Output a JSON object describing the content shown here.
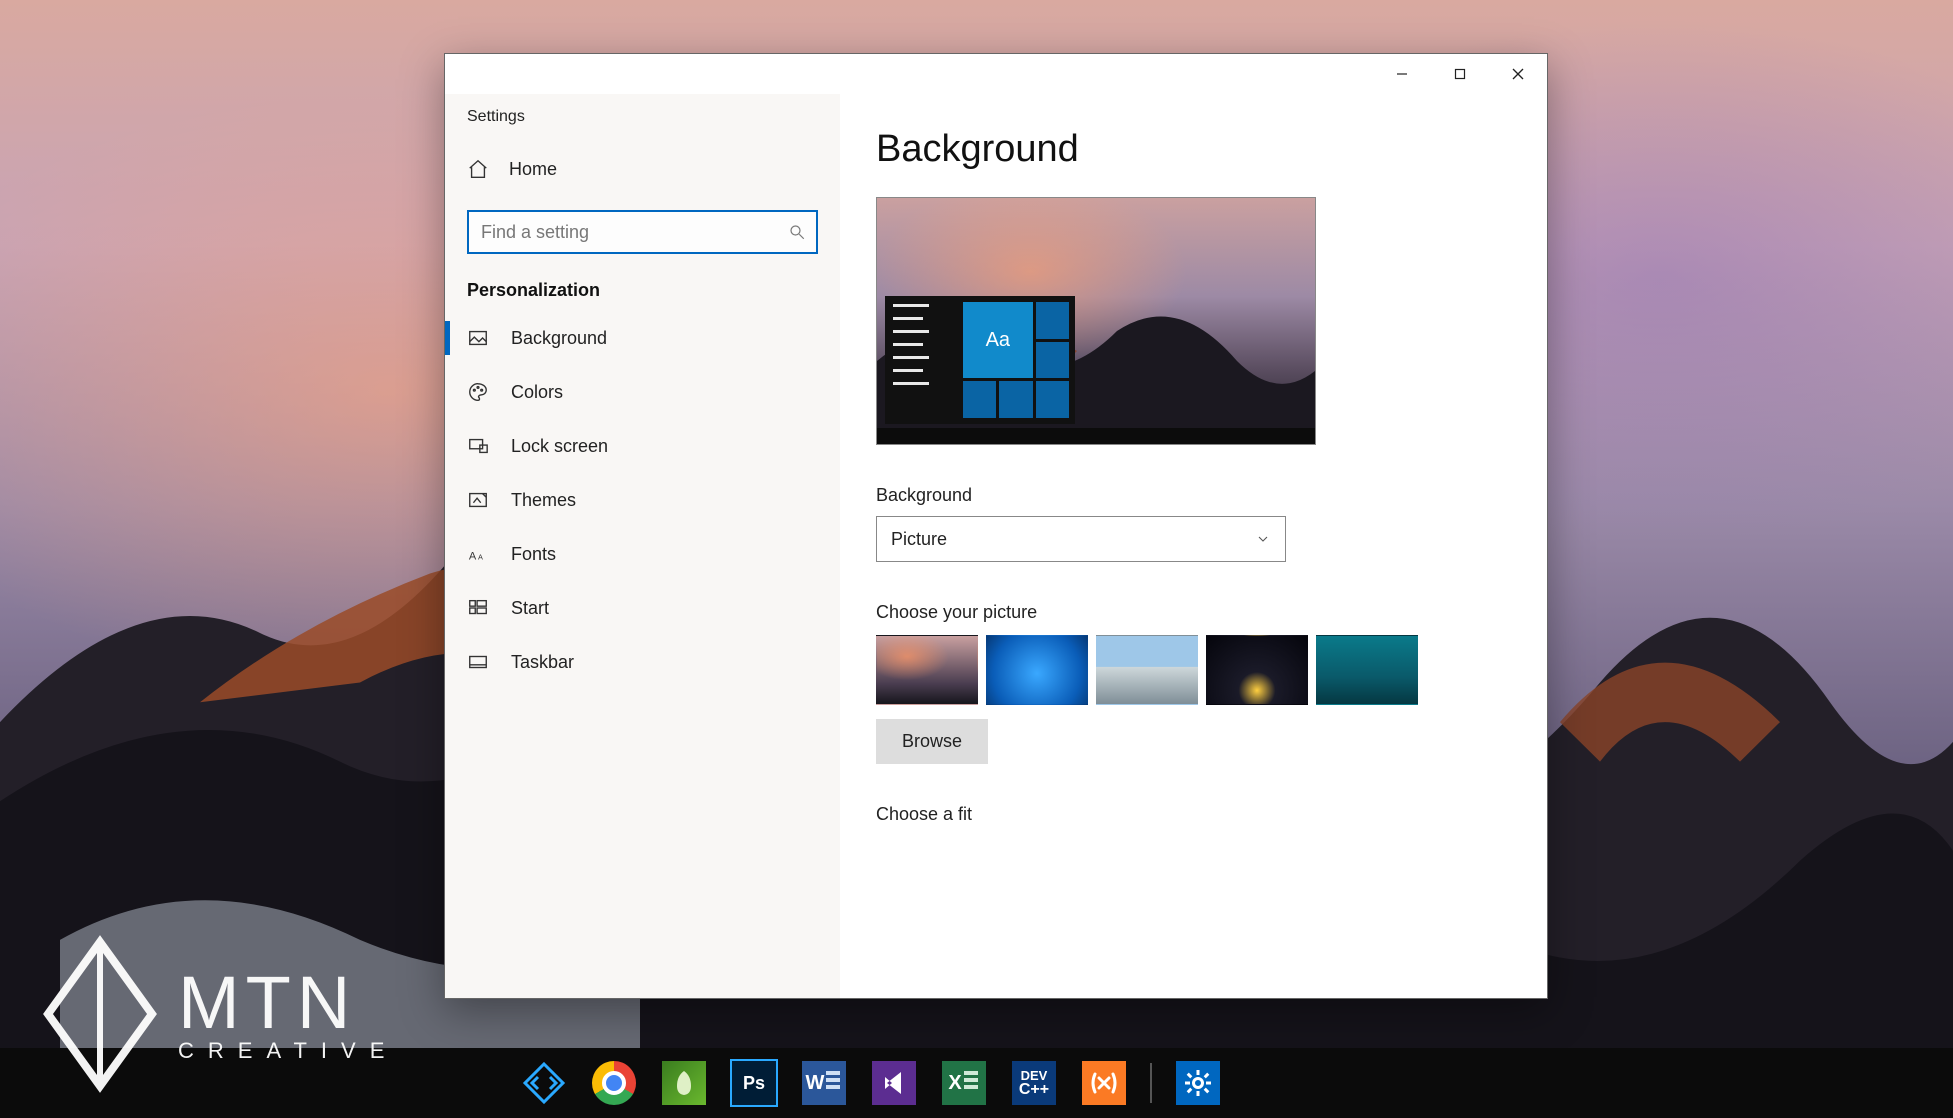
{
  "window": {
    "title": "Settings"
  },
  "sidebar": {
    "home_label": "Home",
    "search_placeholder": "Find a setting",
    "section_header": "Personalization",
    "items": [
      {
        "label": "Background"
      },
      {
        "label": "Colors"
      },
      {
        "label": "Lock screen"
      },
      {
        "label": "Themes"
      },
      {
        "label": "Fonts"
      },
      {
        "label": "Start"
      },
      {
        "label": "Taskbar"
      }
    ]
  },
  "content": {
    "page_title": "Background",
    "preview_tile_text": "Aa",
    "bg_label": "Background",
    "bg_selected": "Picture",
    "choose_picture_label": "Choose your picture",
    "browse_label": "Browse",
    "choose_fit_label": "Choose a fit"
  },
  "taskbar": {
    "apps": [
      {
        "name": "start-like",
        "label": ""
      },
      {
        "name": "chrome",
        "label": ""
      },
      {
        "name": "coreldraw",
        "label": ""
      },
      {
        "name": "photoshop",
        "label": "Ps"
      },
      {
        "name": "word",
        "label": "W"
      },
      {
        "name": "visual-studio",
        "label": ""
      },
      {
        "name": "excel",
        "label": "X"
      },
      {
        "name": "dev-cpp",
        "label": "DEV"
      },
      {
        "name": "xampp",
        "label": ""
      },
      {
        "name": "separator",
        "label": ""
      },
      {
        "name": "settings",
        "label": ""
      }
    ]
  },
  "watermark": {
    "line1": "MTN",
    "line2": "CREATIVE"
  }
}
